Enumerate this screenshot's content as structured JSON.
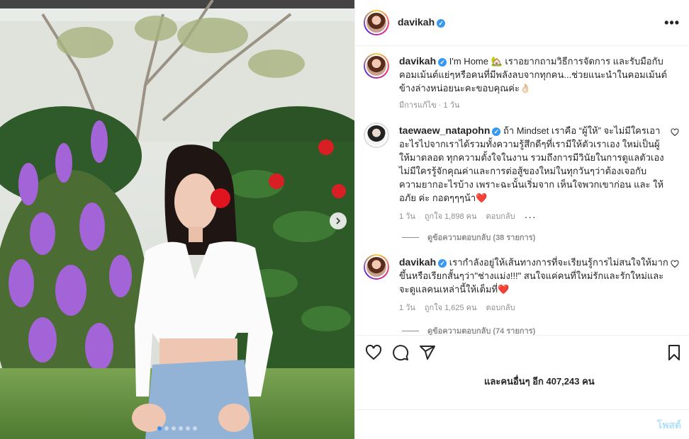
{
  "header": {
    "username": "davikah",
    "more_icon": "more-horizontal-icon"
  },
  "caption": {
    "username": "davikah",
    "text": "I'm Home 🏡 เราอยากถามวิธีการจัดการ และรับมือกับคอมเม้นต์แย่ๆหรือคนที่มีพลังลบจากทุกคน...ช่วยแนะนำในคอมเม้นต์ข้างล่างหน่อยนะคะขอบคุณค่ะ👌🏻",
    "edited": "มีการแก้ไข",
    "time": "1 วัน"
  },
  "comments": [
    {
      "username": "taewaew_natapohn",
      "text": "ถ้า Mindset เราคือ “ผู้ให้” จะไม่มีใครเอาอะไรไปจากเราได้รวมทั้งความรู้สึกดีๆที่เรามีให้ตัวเราเอง ใหม่เป็นผู้ให้มาตลอด ทุกความตั้งใจในงาน รวมถึงการมีวินัยในการดูแลตัวเอง ไม่มีใครรู้จักคุณค่าและการต่อสู้ของใหม่ในทุกวันๆว่าต้องเจอกับความยากอะไรบ้าง เพราะฉะนั้นเริ่มจาก เห็นใจพวกเขาก่อน และ ให้อภัย ค่ะ กอดๆๆๆน้า",
      "heart": "❤️",
      "time": "1 วัน",
      "likes": "ถูกใจ 1,898 คน",
      "reply": "ตอบกลับ",
      "view_replies": "ดูข้อความตอบกลับ (38 รายการ)"
    },
    {
      "username": "davikah",
      "text": "เรากำลังอยู่ให้เส้นทางการที่จะเรียนรู้การไม่สนใจให้มากขึ้นหรือเรียกสั้นๆว่า\"ช่างแม่ง!!!\" สนใจแค่คนที่ใหม่รักและรักใหม่และจะดูแลคนเหล่านี้ให้เต็มที่",
      "heart": "❤️",
      "time": "1 วัน",
      "likes": "ถูกใจ 1,625 คน",
      "reply": "ตอบกลับ",
      "view_replies": "ดูข้อความตอบกลับ (74 รายการ)"
    }
  ],
  "actions": {
    "like_icon": "heart-outline-icon",
    "comment_icon": "comment-icon",
    "share_icon": "paper-plane-icon",
    "save_icon": "bookmark-icon",
    "likes_text": "และคนอื่นๆ อีก 407,243 คน"
  },
  "composer": {
    "post_label": "โพสต์"
  },
  "carousel": {
    "slide_count": 6,
    "active_index": 0
  },
  "colors": {
    "verified": "#3897f0",
    "post_disabled": "#b2dffc",
    "active_dot": "#3b8ff0"
  }
}
